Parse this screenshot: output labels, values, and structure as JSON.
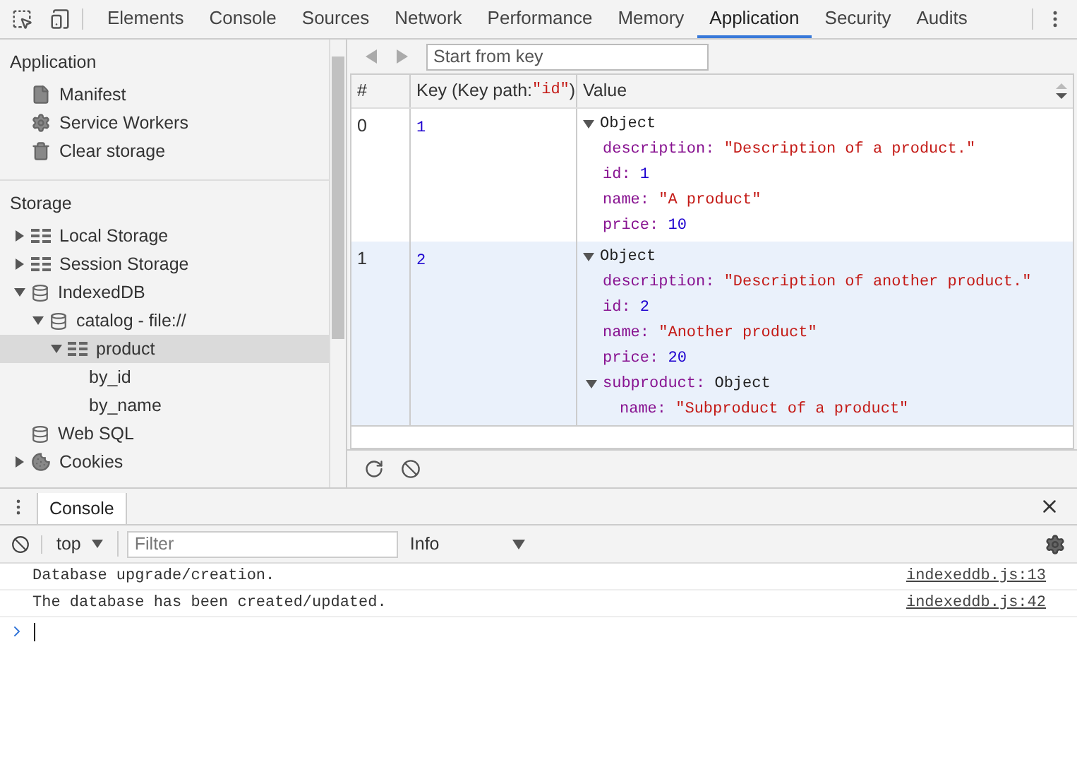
{
  "panel_tabs": [
    {
      "label": "Elements",
      "selected": false
    },
    {
      "label": "Console",
      "selected": false
    },
    {
      "label": "Sources",
      "selected": false
    },
    {
      "label": "Network",
      "selected": false
    },
    {
      "label": "Performance",
      "selected": false
    },
    {
      "label": "Memory",
      "selected": false
    },
    {
      "label": "Application",
      "selected": true
    },
    {
      "label": "Security",
      "selected": false
    },
    {
      "label": "Audits",
      "selected": false
    }
  ],
  "sidebar": {
    "sections": [
      {
        "title": "Application",
        "items": [
          {
            "label": "Manifest",
            "kind": "file",
            "selected": false
          },
          {
            "label": "Service Workers",
            "kind": "gear",
            "selected": false
          },
          {
            "label": "Clear storage",
            "kind": "trash",
            "selected": false
          }
        ]
      },
      {
        "title": "Storage",
        "items": [
          {
            "label": "Local Storage",
            "kind": "grid",
            "expanded": false,
            "selected": false
          },
          {
            "label": "Session Storage",
            "kind": "grid",
            "expanded": false,
            "selected": false
          },
          {
            "label": "IndexedDB",
            "kind": "database",
            "expanded": true,
            "selected": false,
            "children": [
              {
                "label": "catalog - file://",
                "kind": "database",
                "expanded": true,
                "selected": false,
                "children": [
                  {
                    "label": "product",
                    "kind": "grid",
                    "expanded": true,
                    "selected": true,
                    "children": [
                      {
                        "label": "by_id",
                        "selected": false
                      },
                      {
                        "label": "by_name",
                        "selected": false
                      }
                    ]
                  }
                ]
              }
            ]
          },
          {
            "label": "Web SQL",
            "kind": "database",
            "selected": false
          },
          {
            "label": "Cookies",
            "kind": "cookie",
            "expanded": false,
            "selected": false
          }
        ]
      }
    ]
  },
  "data_view": {
    "key_placeholder": "Start from key",
    "columns": [
      {
        "label": "#"
      },
      {
        "label": "Key (Key path: ",
        "code": "\"id\"",
        "tail": ")"
      },
      {
        "label": "Value"
      }
    ],
    "rows": [
      {
        "index": "0",
        "key": "1",
        "selected": false,
        "value": {
          "label": "Object",
          "expanded": true,
          "props": [
            {
              "name": "description:",
              "kind": "string",
              "value": "\"Description of a product.\""
            },
            {
              "name": "id:",
              "kind": "number",
              "value": "1"
            },
            {
              "name": "name:",
              "kind": "string",
              "value": "\"A product\""
            },
            {
              "name": "price:",
              "kind": "number",
              "value": "10"
            }
          ]
        }
      },
      {
        "index": "1",
        "key": "2",
        "selected": true,
        "value": {
          "label": "Object",
          "expanded": true,
          "props": [
            {
              "name": "description:",
              "kind": "string",
              "value": "\"Description of another product.\""
            },
            {
              "name": "id:",
              "kind": "number",
              "value": "2"
            },
            {
              "name": "name:",
              "kind": "string",
              "value": "\"Another product\""
            },
            {
              "name": "price:",
              "kind": "number",
              "value": "20"
            },
            {
              "name": "subproduct:",
              "kind": "object",
              "value": "Object",
              "expanded": true,
              "children": [
                {
                  "name": "name:",
                  "kind": "string",
                  "value": "\"Subproduct of a product\""
                }
              ]
            }
          ]
        }
      }
    ]
  },
  "drawer": {
    "tabs": [
      {
        "label": "Console",
        "selected": true
      }
    ],
    "context": "top",
    "filter_placeholder": "Filter",
    "log_level": "Info",
    "messages": [
      {
        "text": "Database upgrade/creation.",
        "source": "indexeddb.js:13"
      },
      {
        "text": "The database has been created/updated.",
        "source": "indexeddb.js:42"
      }
    ]
  }
}
